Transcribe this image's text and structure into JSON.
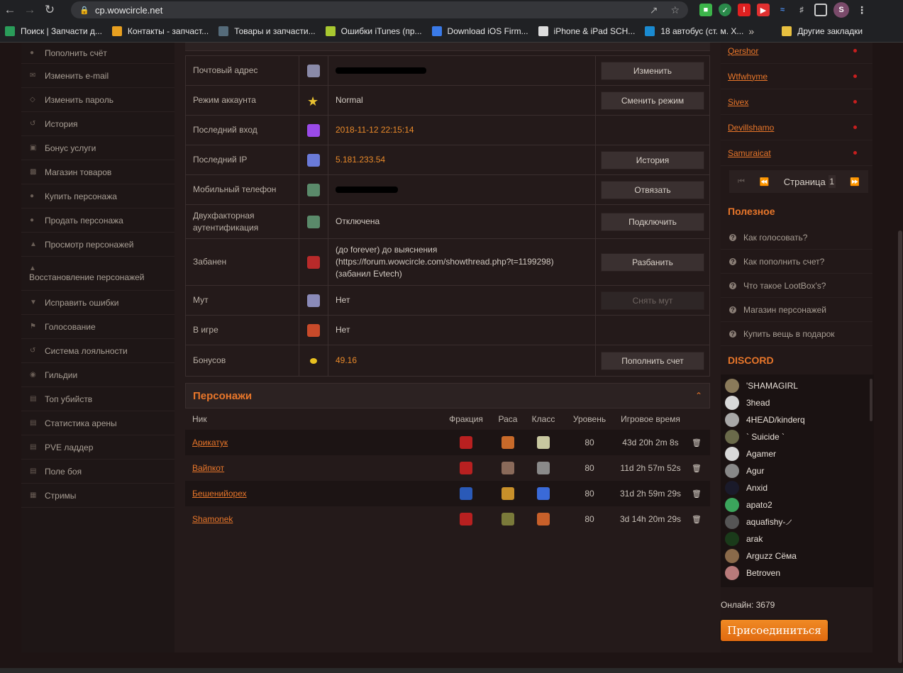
{
  "browser": {
    "url": "cp.wowcircle.net",
    "profile_initial": "S"
  },
  "bookmarks": [
    {
      "label": "Поиск | Запчасти д...",
      "color": "#2a9d5a"
    },
    {
      "label": "Контакты - запчаст...",
      "color": "#e8a020"
    },
    {
      "label": "Товары и запчасти...",
      "color": "#556b7a"
    },
    {
      "label": "Ошибки iTunes (пр...",
      "color": "#a8c830"
    },
    {
      "label": "Download iOS Firm...",
      "color": "#3a7ae8"
    },
    {
      "label": "iPhone & iPad SCH...",
      "color": "#dddddd"
    },
    {
      "label": "18 автобус (ст. м. Х...",
      "color": "#1a8ad0"
    },
    {
      "label": "Другие закладки",
      "color": "#e8c040"
    }
  ],
  "sidebar": {
    "items": [
      {
        "label": "Пополнить счёт",
        "icon": "plus-circle-icon"
      },
      {
        "label": "Изменить e-mail",
        "icon": "envelope-icon"
      },
      {
        "label": "Изменить пароль",
        "icon": "lock-icon"
      },
      {
        "label": "История",
        "icon": "history-icon"
      },
      {
        "label": "Бонус услуги",
        "icon": "bonus-icon"
      },
      {
        "label": "Магазин товаров",
        "icon": "cart-icon"
      },
      {
        "label": "Купить персонажа",
        "icon": "user-icon"
      },
      {
        "label": "Продать персонажа",
        "icon": "user-icon"
      },
      {
        "label": "Просмотр персонажей",
        "icon": "person-icon"
      },
      {
        "label": "Восстановление персонажей",
        "icon": "person-icon"
      },
      {
        "label": "Исправить ошибки",
        "icon": "shield-icon"
      },
      {
        "label": "Голосование",
        "icon": "flag-icon"
      },
      {
        "label": "Система лояльности",
        "icon": "history-icon"
      },
      {
        "label": "Гильдии",
        "icon": "group-icon"
      },
      {
        "label": "Топ убийств",
        "icon": "chart-icon"
      },
      {
        "label": "Статистика арены",
        "icon": "chart-icon"
      },
      {
        "label": "PVE ладдер",
        "icon": "chart-icon"
      },
      {
        "label": "Поле боя",
        "icon": "chart-icon"
      },
      {
        "label": "Стримы",
        "icon": "stream-icon"
      }
    ]
  },
  "account": {
    "rows": [
      {
        "label": "Почтовый адрес",
        "value": "",
        "button": "Изменить"
      },
      {
        "label": "Режим аккаунта",
        "value": "Normal",
        "button": "Сменить режим"
      },
      {
        "label": "Последний вход",
        "value": "2018-11-12 22:15:14",
        "button": ""
      },
      {
        "label": "Последний IP",
        "value": "5.181.233.54",
        "button": "История"
      },
      {
        "label": "Мобильный телефон",
        "value": "",
        "button": "Отвязать"
      },
      {
        "label": "Двухфакторная аутентификация",
        "value": "Отключена",
        "button": "Подключить"
      },
      {
        "label": "Забанен",
        "value": "(до forever) до выяснения (https://forum.wowcircle.com/showthread.php?t=1199298) (забанил Evtech)",
        "button": "Разбанить"
      },
      {
        "label": "Мут",
        "value": "Нет",
        "button": "Снять мут"
      },
      {
        "label": "В игре",
        "value": "Нет",
        "button": ""
      },
      {
        "label": "Бонусов",
        "value": "49.16",
        "button": "Пополнить счет"
      }
    ]
  },
  "characters": {
    "title": "Персонажи",
    "headers": {
      "nick": "Ник",
      "faction": "Фракция",
      "race": "Раса",
      "class": "Класс",
      "level": "Уровень",
      "time": "Игровое время"
    },
    "rows": [
      {
        "nick": "Арикатук",
        "level": "80",
        "time": "43d 20h 2m 8s"
      },
      {
        "nick": "Вайпкот",
        "level": "80",
        "time": "11d 2h 57m 52s"
      },
      {
        "nick": "Бешенийорех",
        "level": "80",
        "time": "31d 2h 59m 29s"
      },
      {
        "nick": "Shamonek",
        "level": "80",
        "time": "3d 14h 20m 29s"
      }
    ]
  },
  "online_list": {
    "names": [
      "Qershor",
      "Wtfwhyme",
      "Sivex",
      "Devillshamo",
      "Samuraicat"
    ],
    "page_label": "Страница",
    "page_value": "1"
  },
  "useful": {
    "title": "Полезное",
    "items": [
      "Как голосовать?",
      "Как пополнить счет?",
      "Что такое LootBox's?",
      "Магазин персонажей",
      "Купить вещь в подарок"
    ]
  },
  "discord": {
    "title": "DISCORD",
    "members": [
      {
        "name": "'SHAMAGIRL",
        "color": "#8a7a5a"
      },
      {
        "name": "3head",
        "color": "#d8d8d8"
      },
      {
        "name": "4HEAD/kinderq",
        "color": "#a8a8a8"
      },
      {
        "name": "` Suicide `",
        "color": "#6a6a4a"
      },
      {
        "name": "Agamer",
        "color": "#d8d8d8"
      },
      {
        "name": "Agur",
        "color": "#888888"
      },
      {
        "name": "Anxid",
        "color": "#1a1a2a"
      },
      {
        "name": "apato2",
        "color": "#3ba55c"
      },
      {
        "name": "aquafishy-୵",
        "color": "#555555"
      },
      {
        "name": "arak",
        "color": "#1a3a1a"
      },
      {
        "name": "Arguzz Сёма",
        "color": "#8a6a4a"
      },
      {
        "name": "Betroven",
        "color": "#b87a7a"
      }
    ],
    "online_text": "Онлайн: 3679",
    "join_label": "Присоединиться"
  }
}
